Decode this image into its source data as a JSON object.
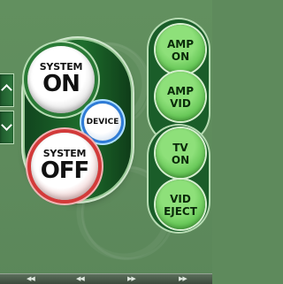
{
  "left_scroll": {
    "up_icon": "chevron-up-icon",
    "down_icon": "chevron-down-icon"
  },
  "main": {
    "system_on": {
      "top": "SYSTEM",
      "main": "ON"
    },
    "device": {
      "label": "DEVICE"
    },
    "system_off": {
      "top": "SYSTEM",
      "main": "OFF"
    }
  },
  "side": {
    "amp_on": {
      "l1": "AMP",
      "l2": "ON"
    },
    "amp_vid": {
      "l1": "AMP",
      "l2": "VID"
    },
    "tv_on": {
      "l1": "TV",
      "l2": "ON"
    },
    "vid_eject": {
      "l1": "VID",
      "l2": "EJECT"
    }
  },
  "bottom_bar": {
    "items": [
      "◀◀",
      "◀◀",
      "▶▶",
      "▶▶"
    ],
    "icons": [
      "rewind-icon",
      "prev-icon",
      "next-icon",
      "fast-forward-icon"
    ]
  },
  "colors": {
    "background": "#5e8a5c",
    "on_ring": "#2a7a36",
    "off_ring": "#d33a3a",
    "device_ring": "#2f7bd6",
    "side_button": "#5bbf4d"
  }
}
